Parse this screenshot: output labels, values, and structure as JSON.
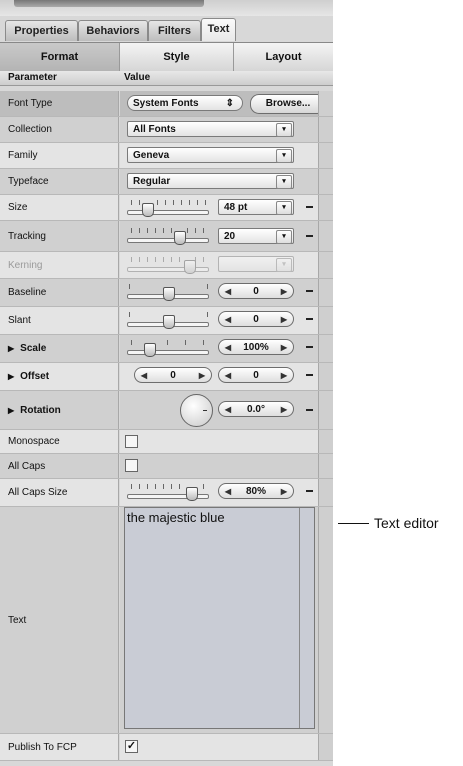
{
  "tabs": [
    "Properties",
    "Behaviors",
    "Filters",
    "Text"
  ],
  "active_tab": "Text",
  "segments": [
    "Format",
    "Style",
    "Layout"
  ],
  "active_segment": "Format",
  "header": {
    "parameter": "Parameter",
    "value": "Value"
  },
  "rows": {
    "font_type": {
      "label": "Font Type",
      "popup": "System Fonts",
      "button": "Browse..."
    },
    "collection": {
      "label": "Collection",
      "value": "All Fonts"
    },
    "family": {
      "label": "Family",
      "value": "Geneva"
    },
    "typeface": {
      "label": "Typeface",
      "value": "Regular"
    },
    "size": {
      "label": "Size",
      "value": "48 pt"
    },
    "tracking": {
      "label": "Tracking",
      "value": "20"
    },
    "kerning": {
      "label": "Kerning"
    },
    "baseline": {
      "label": "Baseline",
      "value": "0"
    },
    "slant": {
      "label": "Slant",
      "value": "0"
    },
    "scale": {
      "label": "Scale",
      "value": "100%"
    },
    "offset": {
      "label": "Offset",
      "x": "0",
      "y": "0"
    },
    "rotation": {
      "label": "Rotation",
      "value": "0.0°"
    },
    "monospace": {
      "label": "Monospace",
      "checked": false
    },
    "all_caps": {
      "label": "All Caps",
      "checked": false
    },
    "all_caps_size": {
      "label": "All Caps Size",
      "value": "80%"
    },
    "text": {
      "label": "Text",
      "content": "the majestic blue"
    },
    "publish": {
      "label": "Publish To FCP",
      "checked": true
    }
  },
  "glyphs": {
    "expand": "▶",
    "popup_arrows": "⇕",
    "step_left": "◀",
    "step_right": "▶",
    "check": "✓",
    "dropdown": "▾"
  },
  "callout": "Text editor"
}
